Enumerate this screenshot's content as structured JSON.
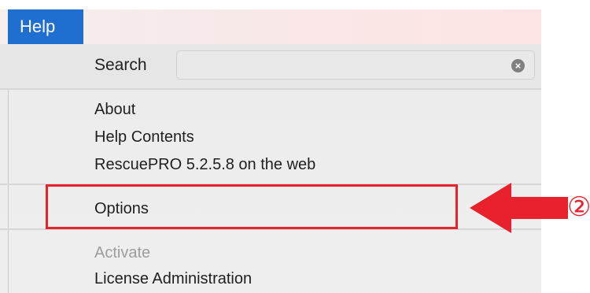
{
  "menubar": {
    "title": "Help"
  },
  "search": {
    "label": "Search",
    "value": "",
    "placeholder": "",
    "clear_icon": "clear-icon"
  },
  "items": {
    "about": "About",
    "help_contents": "Help Contents",
    "rescuepro_web": "RescuePRO 5.2.5.8 on the web",
    "options": "Options",
    "activate": "Activate",
    "license_admin": "License Administration"
  },
  "annotation": {
    "step_label": "②",
    "highlight_color": "#e8212d",
    "arrow_icon": "arrow-left-icon"
  },
  "colors": {
    "menu_title_bg": "#1f6fd1",
    "accent": "#e8212d"
  }
}
